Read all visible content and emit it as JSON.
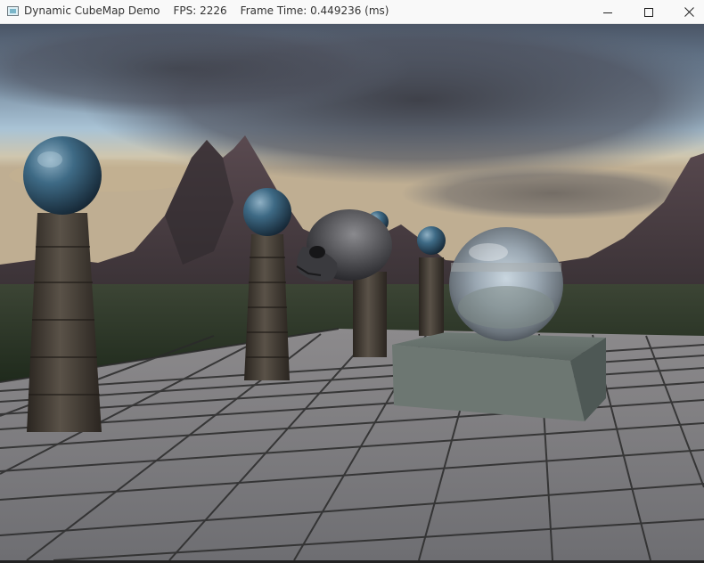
{
  "window": {
    "title_app": "Dynamic CubeMap Demo",
    "title_fps": "FPS: 2226",
    "title_frametime": "Frame Time: 0.449236 (ms)",
    "controls": {
      "minimize": "minimize-icon",
      "maximize": "maximize-icon",
      "close": "close-icon"
    }
  },
  "scene": {
    "description_icons": [
      "sky",
      "mountains",
      "stone-columns",
      "blue-marble-spheres",
      "skull",
      "mirror-sphere",
      "stone-box",
      "tiled-floor"
    ],
    "colors": {
      "sky_top": "#3b4a5e",
      "sky_mid": "#8fb0c7",
      "horizon": "#d9c7a3",
      "mountain": "#4a3f44",
      "grass": "#2c3a28",
      "floor": "#7a7a7e",
      "floor_line": "#2a2a2a"
    }
  }
}
